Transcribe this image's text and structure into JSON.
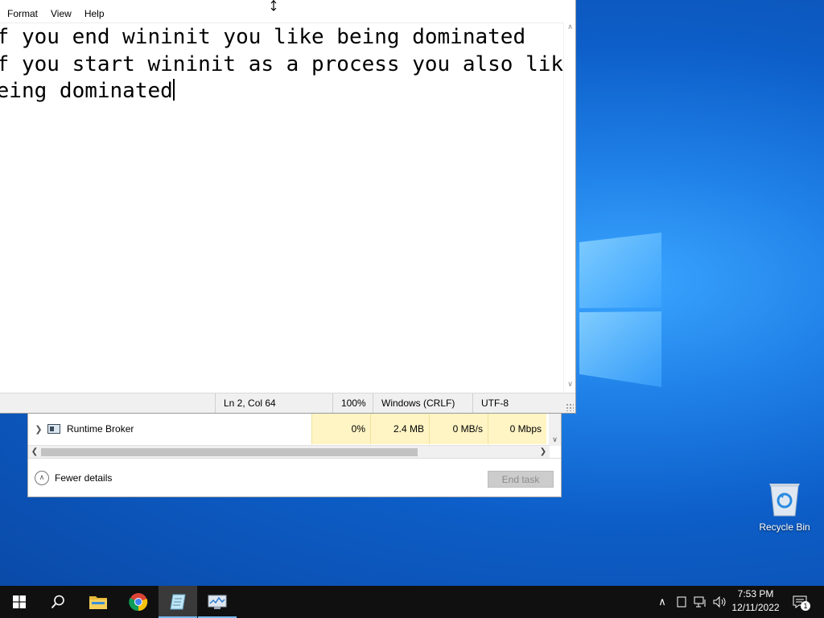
{
  "notepad": {
    "menu": [
      "Format",
      "View",
      "Help"
    ],
    "lines": [
      "if you end wininit you like being dominated",
      "if you start wininit as a process you also like",
      "being dominated"
    ],
    "status": {
      "position": "Ln 2, Col 64",
      "zoom": "100%",
      "line_ending": "Windows (CRLF)",
      "encoding": "UTF-8"
    }
  },
  "task_manager": {
    "row": {
      "name": "Runtime Broker",
      "cpu": "0%",
      "memory": "2.4 MB",
      "disk": "0 MB/s",
      "network": "0 Mbps"
    },
    "fewer_details_label": "Fewer details",
    "end_task_label": "End task"
  },
  "desktop": {
    "recycle_bin_label": "Recycle Bin"
  },
  "taskbar": {
    "time": "7:53 PM",
    "date": "12/11/2022",
    "notification_count": "1",
    "pinned_icons": [
      "windows-start-icon",
      "search-icon",
      "file-explorer-icon",
      "chrome-icon",
      "notepad-icon",
      "task-manager-icon"
    ],
    "active_app": "notepad-icon",
    "colors": {
      "taskbar_bg": "#101010",
      "active_indicator": "#76b9ed",
      "desktop_accent": "#1e7fe6"
    }
  }
}
